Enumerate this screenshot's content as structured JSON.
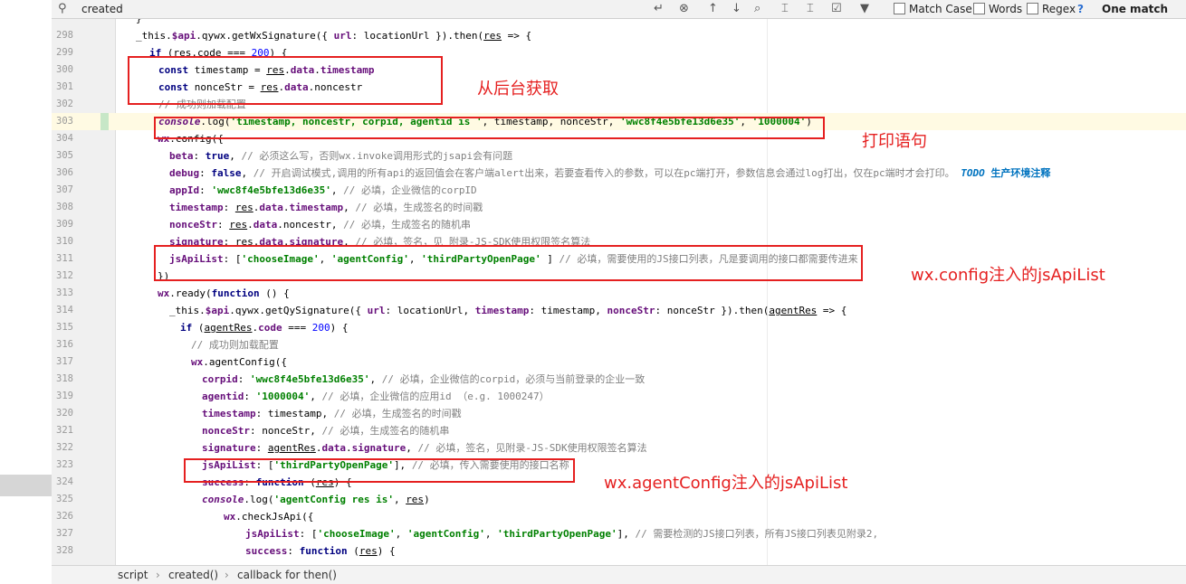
{
  "search": {
    "value": "created",
    "match_case": "Match Case",
    "words": "Words",
    "regex": "Regex",
    "help": "?",
    "result": "One match"
  },
  "lines": [
    {
      "n": "",
      "html": "<span class=\"plain\">}</span>"
    },
    {
      "n": "298",
      "html": "<span class=\"plain\">_this.</span><span class=\"prop\">$api</span><span class=\"plain\">.qywx.getWxSignature({ </span><span class=\"prop\">url</span><span class=\"plain\">: locationUrl }).then(</span><span class=\"plain\"><u>res</u></span><span class=\"plain\"> =&gt; {</span>"
    },
    {
      "n": "299",
      "html": "<span class=\"kw\">if</span><span class=\"plain\"> (</span><span class=\"plain\"><u>res</u></span><span class=\"plain\">.code === </span><span class=\"num\">200</span><span class=\"plain\">) {</span>"
    },
    {
      "n": "300",
      "html": "<span class=\"kw\">const</span><span class=\"plain\"> timestamp = </span><span class=\"plain\"><u>res</u></span><span class=\"plain\">.</span><span class=\"prop\">data</span><span class=\"plain\">.</span><span class=\"prop\">timestamp</span>"
    },
    {
      "n": "301",
      "html": "<span class=\"kw\">const</span><span class=\"plain\"> nonceStr = </span><span class=\"plain\"><u>res</u></span><span class=\"plain\">.</span><span class=\"prop\">data</span><span class=\"plain\">.noncestr</span>"
    },
    {
      "n": "302",
      "html": "<span class=\"cmt\">// 成功则加载配置</span>"
    },
    {
      "n": "303",
      "html": "<span class=\"con\">console</span><span class=\"plain\">.log(</span><span class=\"str\">'timestamp, noncestr, corpid, agentid is '</span><span class=\"plain\">, timestamp, nonceStr, </span><span class=\"str\">'wwc8f4e5bfe13d6e35'</span><span class=\"plain\">, </span><span class=\"str\">'1000004'</span><span class=\"plain\">)</span>"
    },
    {
      "n": "304",
      "html": "<span class=\"prop\">wx</span><span class=\"plain\">.config({</span>"
    },
    {
      "n": "305",
      "html": "<span class=\"prop\">beta</span><span class=\"plain\">: </span><span class=\"kw\">true</span><span class=\"plain\">, </span><span class=\"cmt\">// 必须这么写，否则wx.invoke调用形式的jsapi会有问题</span>"
    },
    {
      "n": "306",
      "html": "<span class=\"prop\">debug</span><span class=\"plain\">: </span><span class=\"kw\">false</span><span class=\"plain\">, </span><span class=\"cmt\">// 开启调试模式,调用的所有api的返回值会在客户端alert出来，若要查看传入的参数，可以在pc端打开，参数信息会通过log打出，仅在pc端时才会打印。 </span><span class=\"todo\">TODO</span><span class=\"todotxt\"> 生产环境注释</span>"
    },
    {
      "n": "307",
      "html": "<span class=\"prop\">appId</span><span class=\"plain\">: </span><span class=\"str\">'wwc8f4e5bfe13d6e35'</span><span class=\"plain\">, </span><span class=\"cmt\">// 必填，企业微信的corpID</span>"
    },
    {
      "n": "308",
      "html": "<span class=\"prop\">timestamp</span><span class=\"plain\">: </span><span class=\"plain\"><u>res</u></span><span class=\"plain\">.</span><span class=\"prop\">data</span><span class=\"plain\">.</span><span class=\"prop\">timestamp</span><span class=\"plain\">, </span><span class=\"cmt\">// 必填，生成签名的时间戳</span>"
    },
    {
      "n": "309",
      "html": "<span class=\"prop\">nonceStr</span><span class=\"plain\">: </span><span class=\"plain\"><u>res</u></span><span class=\"plain\">.</span><span class=\"prop\">data</span><span class=\"plain\">.noncestr, </span><span class=\"cmt\">// 必填，生成签名的随机串</span>"
    },
    {
      "n": "310",
      "html": "<span class=\"prop\">signature</span><span class=\"plain\">: </span><span class=\"plain\"><u>res</u></span><span class=\"plain\">.</span><span class=\"prop\">data</span><span class=\"plain\">.</span><span class=\"prop\">signature</span><span class=\"plain\">, </span><span class=\"cmt\">// 必填，签名，见 附录-JS-SDK使用权限签名算法</span>"
    },
    {
      "n": "311",
      "html": "<span class=\"prop\">jsApiList</span><span class=\"plain\">: [</span><span class=\"str\">'chooseImage'</span><span class=\"plain\">, </span><span class=\"str\">'agentConfig'</span><span class=\"plain\">, </span><span class=\"str\">'thirdPartyOpenPage'</span><span class=\"plain\"> ] </span><span class=\"cmt\">// 必填，需要使用的JS接口列表，凡是要调用的接口都需要传进来</span>"
    },
    {
      "n": "312",
      "html": "<span class=\"plain\">})</span>"
    },
    {
      "n": "313",
      "html": "<span class=\"prop\">wx</span><span class=\"plain\">.ready(</span><span class=\"kw\">function</span><span class=\"plain\"> () {</span>"
    },
    {
      "n": "314",
      "html": "<span class=\"plain\">_this.</span><span class=\"prop\">$api</span><span class=\"plain\">.qywx.getQySignature({ </span><span class=\"prop\">url</span><span class=\"plain\">: locationUrl, </span><span class=\"prop\">timestamp</span><span class=\"plain\">: timestamp, </span><span class=\"prop\">nonceStr</span><span class=\"plain\">: nonceStr }).then(</span><span class=\"plain\"><u>agentRes</u></span><span class=\"plain\"> =&gt; {</span>"
    },
    {
      "n": "315",
      "html": "<span class=\"kw\">if</span><span class=\"plain\"> (</span><span class=\"plain\"><u>agentRes</u></span><span class=\"plain\">.</span><span class=\"prop\">code</span><span class=\"plain\"> === </span><span class=\"num\">200</span><span class=\"plain\">) {</span>"
    },
    {
      "n": "316",
      "html": "<span class=\"cmt\">// 成功则加载配置</span>"
    },
    {
      "n": "317",
      "html": "<span class=\"prop\">wx</span><span class=\"plain\">.agentConfig({</span>"
    },
    {
      "n": "318",
      "html": "<span class=\"prop\">corpid</span><span class=\"plain\">: </span><span class=\"str\">'wwc8f4e5bfe13d6e35'</span><span class=\"plain\">, </span><span class=\"cmt\">// 必填，企业微信的corpid，必须与当前登录的企业一致</span>"
    },
    {
      "n": "319",
      "html": "<span class=\"prop\">agentid</span><span class=\"plain\">: </span><span class=\"str\">'1000004'</span><span class=\"plain\">, </span><span class=\"cmt\">// 必填，企业微信的应用id （e.g. 1000247）</span>"
    },
    {
      "n": "320",
      "html": "<span class=\"prop\">timestamp</span><span class=\"plain\">: timestamp, </span><span class=\"cmt\">// 必填，生成签名的时间戳</span>"
    },
    {
      "n": "321",
      "html": "<span class=\"prop\">nonceStr</span><span class=\"plain\">: nonceStr, </span><span class=\"cmt\">// 必填，生成签名的随机串</span>"
    },
    {
      "n": "322",
      "html": "<span class=\"prop\">signature</span><span class=\"plain\">: </span><span class=\"plain\"><u>agentRes</u></span><span class=\"plain\">.</span><span class=\"prop\">data</span><span class=\"plain\">.</span><span class=\"prop\">signature</span><span class=\"plain\">, </span><span class=\"cmt\">// 必填，签名，见附录-JS-SDK使用权限签名算法</span>"
    },
    {
      "n": "323",
      "html": "<span class=\"prop\">jsApiList</span><span class=\"plain\">: [</span><span class=\"str\">'thirdPartyOpenPage'</span><span class=\"plain\">], </span><span class=\"cmt\">// 必填，传入需要使用的接口名称</span>"
    },
    {
      "n": "324",
      "html": "<span class=\"prop\">success</span><span class=\"plain\">: </span><span class=\"kw\">function</span><span class=\"plain\"> (</span><span class=\"plain\"><u>res</u></span><span class=\"plain\">) {</span>"
    },
    {
      "n": "325",
      "html": "<span class=\"con\">console</span><span class=\"plain\">.log(</span><span class=\"str\">'agentConfig res is'</span><span class=\"plain\">, </span><span class=\"plain\"><u>res</u></span><span class=\"plain\">)</span>"
    },
    {
      "n": "326",
      "html": "<span class=\"prop\">wx</span><span class=\"plain\">.checkJsApi({</span>"
    },
    {
      "n": "327",
      "html": "<span class=\"prop\">jsApiList</span><span class=\"plain\">: [</span><span class=\"str\">'chooseImage'</span><span class=\"plain\">, </span><span class=\"str\">'agentConfig'</span><span class=\"plain\">, </span><span class=\"str\">'thirdPartyOpenPage'</span><span class=\"plain\">], </span><span class=\"cmt\">// 需要检测的JS接口列表，所有JS接口列表见附录2,</span>"
    },
    {
      "n": "328",
      "html": "<span class=\"prop\">success</span><span class=\"plain\">: </span><span class=\"kw\">function</span><span class=\"plain\"> (</span><span class=\"plain\"><u>res</u></span><span class=\"plain\">) {</span>"
    }
  ],
  "annotations": {
    "backend": "从后台获取",
    "print": "打印语句",
    "config_list": "wx.config注入的jsApiList",
    "agent_list": "wx.agentConfig注入的jsApiList"
  },
  "breadcrumb": [
    "script",
    "created()",
    "callback for then()"
  ],
  "colors": {
    "annotation": "#e52020",
    "current_line": "#fffae3"
  }
}
